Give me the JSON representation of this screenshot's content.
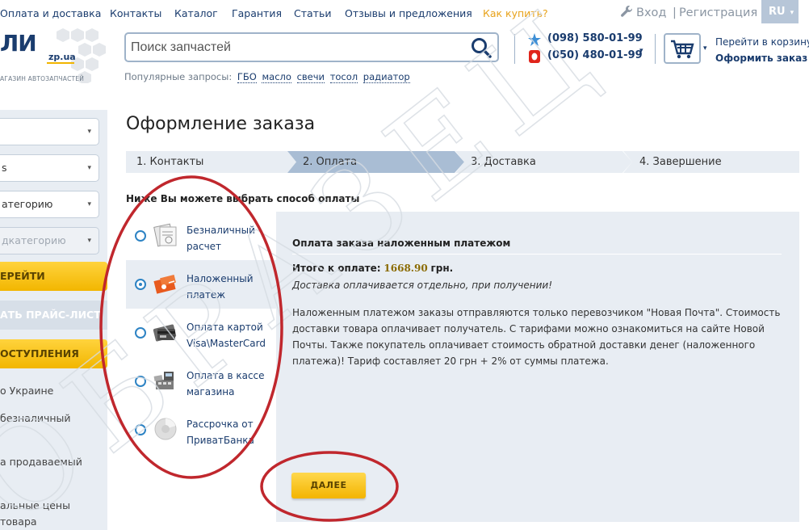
{
  "topnav": {
    "items": [
      "Оплата и доставка",
      "Контакты",
      "Каталог",
      "Гарантия",
      "Статьи",
      "Отзывы и предложения",
      "Как купить?"
    ],
    "login": "Вход",
    "separator": "|",
    "register": "Регистрация",
    "lang": "RU",
    "lang_caret": "▾"
  },
  "logo": {
    "text": "ЛИ",
    "domain": "zp.ua",
    "tagline": "АГАЗИН АВТОЗАПЧАСТЕЙ"
  },
  "search": {
    "placeholder": "Поиск запчастей",
    "icon": "search-icon"
  },
  "popular": {
    "label": "Популярные запросы:",
    "items": [
      "ГБО",
      "масло",
      "свечи",
      "тосол",
      "радиатор"
    ]
  },
  "phones": {
    "phone1": "(098) 580-01-99",
    "phone2": "(050) 480-01-99",
    "caret": "▾"
  },
  "cart": {
    "link1": "Перейти в корзину",
    "link2": "Оформить заказ",
    "caret": "▾"
  },
  "sidebar": {
    "selects": [
      "",
      "s",
      "атегорию",
      "дкатегорию"
    ],
    "caret": "▾",
    "go_button": "ЕРЕЙТИ",
    "pricelist_button": "АТЬ ПРАЙС-ЛИСТ",
    "arrivals_button": "ОСТУПЛЕНИЯ",
    "info": [
      "о Украине",
      "безналичный",
      "а продаваемый",
      "альные цены",
      "товара"
    ]
  },
  "main": {
    "title": "Оформление заказа",
    "steps": [
      "1. Контакты",
      "2. Оплата",
      "3. Доставка",
      "4. Завершение"
    ],
    "choose_text": "Ниже Вы можете выбрать способ оплаты",
    "methods": [
      {
        "label": "Безналичный расчет",
        "icon": "invoice-icon",
        "selected": false
      },
      {
        "label": "Наложенный платеж",
        "icon": "cod-package-icon",
        "selected": true
      },
      {
        "label": "Оплата картой Visa\\MasterCard",
        "icon": "credit-card-icon",
        "selected": false
      },
      {
        "label": "Оплата в кассе магазина",
        "icon": "cash-register-icon",
        "selected": false
      },
      {
        "label": "Рассрочка от ПриватБанка",
        "icon": "installment-icon",
        "selected": false
      }
    ]
  },
  "panel": {
    "title": "Оплата заказа наложенным платежом",
    "total_label": "Итого к оплате:",
    "total_amount": "1668.90",
    "total_currency": "грн.",
    "note": "Доставка оплачивается отдельно, при получении!",
    "description": "Наложенным платежом заказы отправляются только перевозчиком \"Новая Почта\". Стоимость доставки товара оплачивает получатель. С тарифами можно ознакомиться на сайте Новой Почты. Также покупатель оплачивает стоимость обратной доставки денег (наложенного платежа)! Тариф составляет 20 грн + 2% от суммы платежа.",
    "next_button": "ДАЛЕЕ"
  },
  "watermark": "ОБРАЗЕЦ",
  "colors": {
    "accent": "#e8a21a",
    "brand": "#1a3c6e",
    "annotation": "#c0272d",
    "panel": "#e8edf3"
  }
}
